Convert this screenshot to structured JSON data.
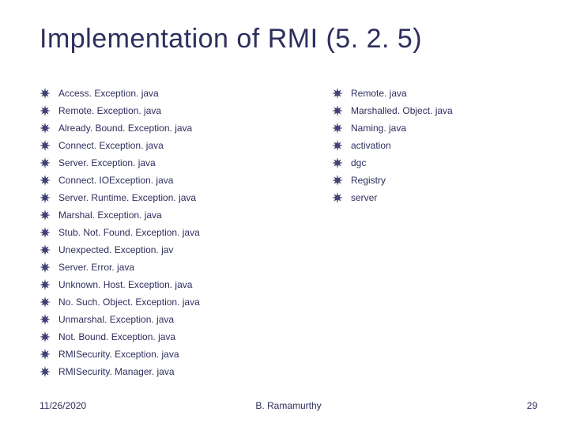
{
  "title": "Implementation of RMI (5. 2. 5)",
  "left_items": [
    "Access. Exception. java",
    "Remote. Exception. java",
    "Already. Bound. Exception. java",
    "Connect. Exception. java",
    "Server. Exception. java",
    "Connect. IOException. java",
    "Server. Runtime. Exception. java",
    "Marshal. Exception. java",
    "Stub. Not. Found. Exception. java",
    "Unexpected. Exception. jav",
    "Server. Error. java",
    "Unknown. Host. Exception. java",
    "No. Such. Object. Exception. java",
    "Unmarshal. Exception. java",
    "Not. Bound. Exception. java",
    "RMISecurity. Exception. java",
    "RMISecurity. Manager. java"
  ],
  "right_items": [
    "Remote. java",
    "Marshalled. Object. java",
    "Naming. java",
    "activation",
    "dgc",
    "Registry",
    "server"
  ],
  "footer": {
    "date": "11/26/2020",
    "author": "B. Ramamurthy",
    "page": "29"
  }
}
